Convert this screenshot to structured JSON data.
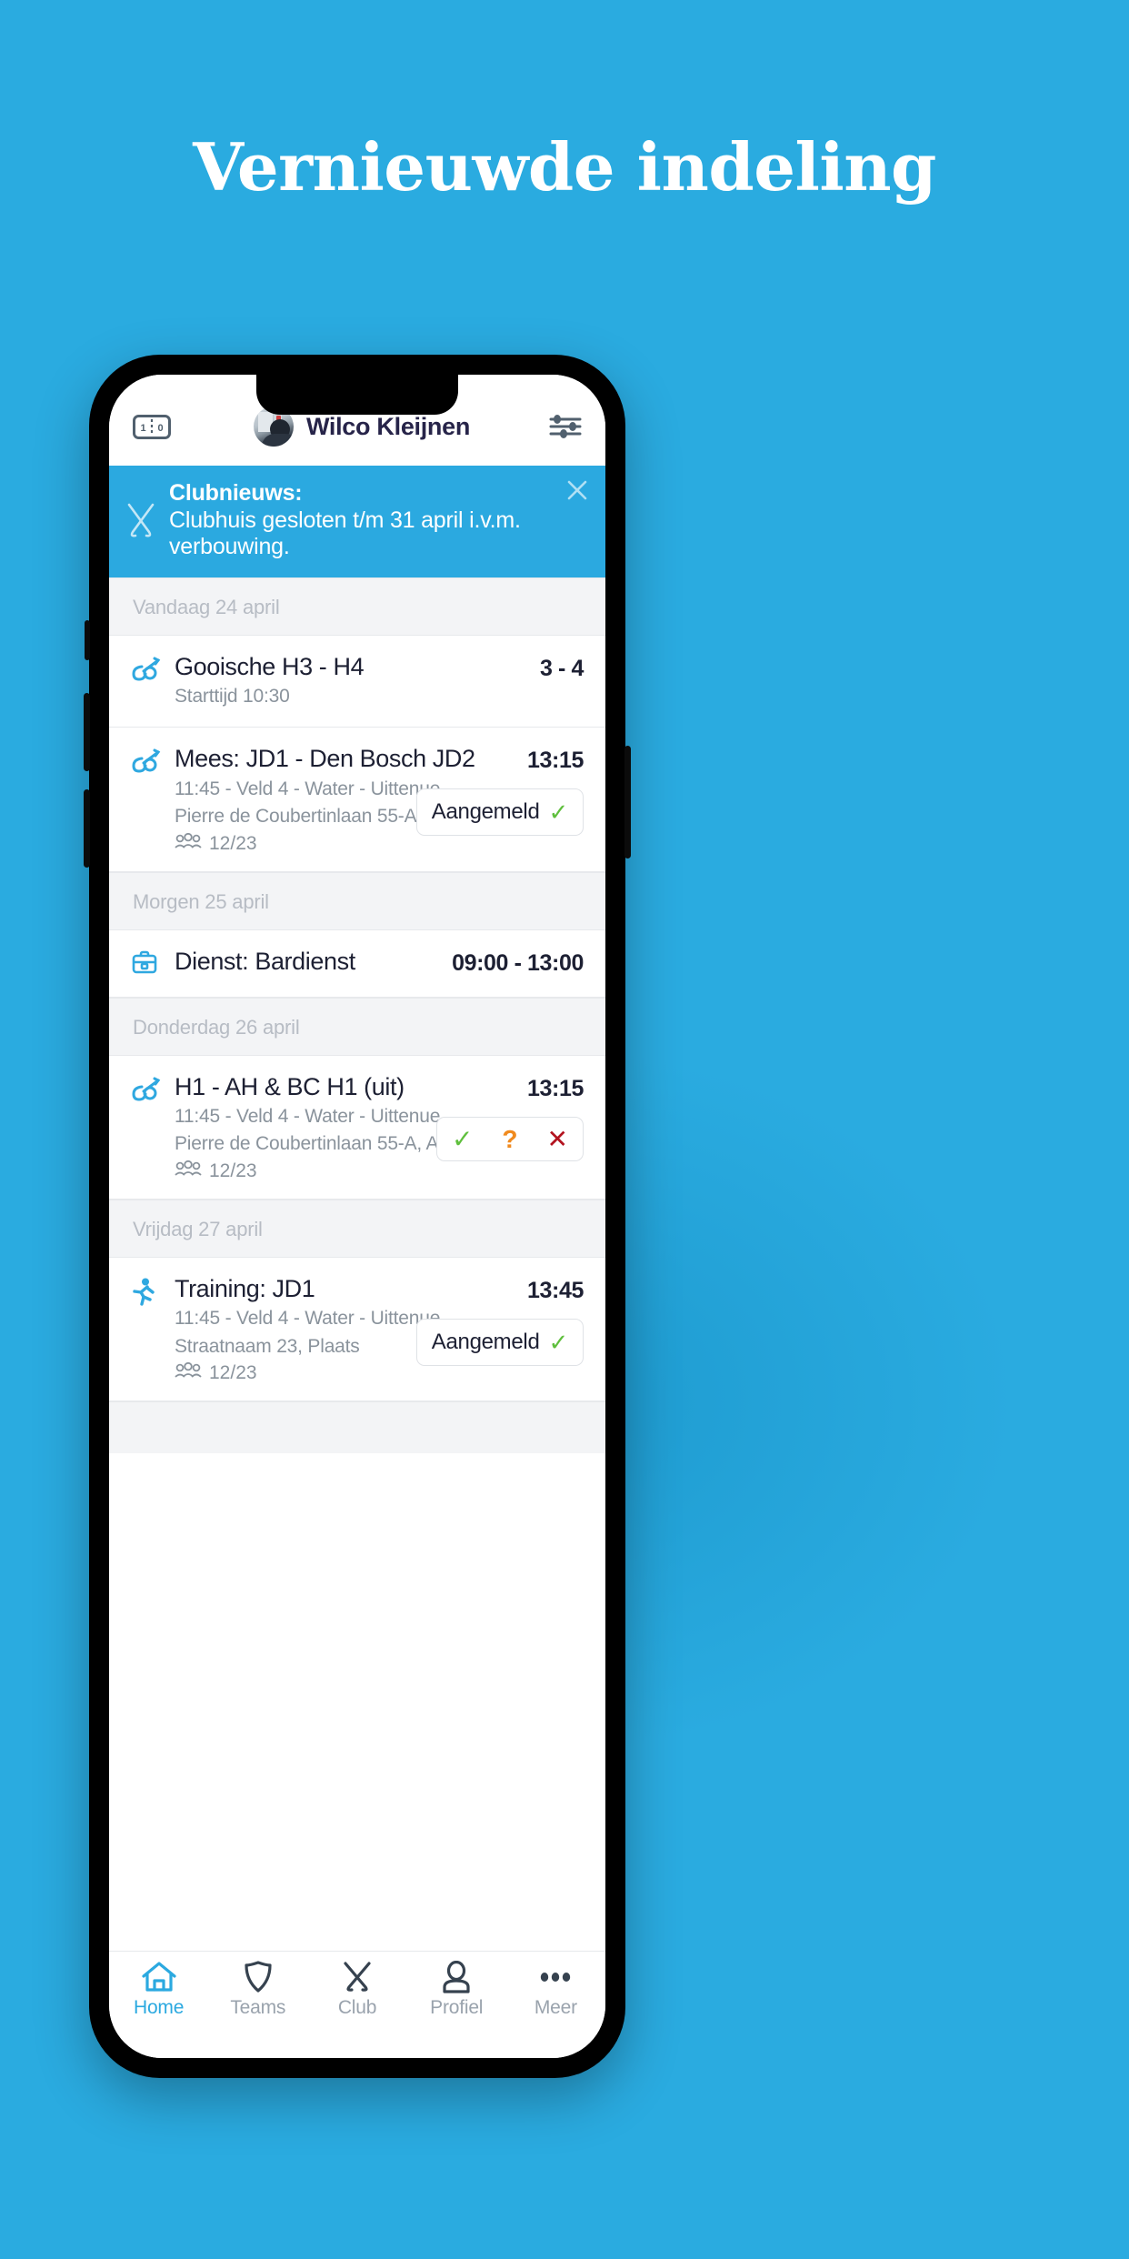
{
  "hero": {
    "title": "Vernieuwde indeling"
  },
  "colors": {
    "background": "#2aabe0",
    "accent": "#2ba9e0",
    "title_text": "#1d2033",
    "muted_text": "#8a939c",
    "day_header_text": "#b7bcc4",
    "yes_green": "#5fbf3d",
    "maybe_orange": "#f08a1e",
    "no_red": "#b3131f"
  },
  "header": {
    "score_icon": "scoreboard-icon",
    "score_left": "1",
    "score_right": "0",
    "avatar_icon": "user-avatar",
    "user_name": "Wilco Kleijnen",
    "settings_icon": "sliders-icon"
  },
  "banner": {
    "icon": "crossed-hockey-sticks-icon",
    "title": "Clubnieuws:",
    "message": "Clubhuis gesloten t/m 31 april i.v.m. verbouwing.",
    "close_icon": "close-icon"
  },
  "sections": [
    {
      "day_label": "Vandaag 24 april",
      "items": [
        {
          "icon": "hockey-stick-ball-icon",
          "title": "Gooische H3 - H4",
          "meta": [
            "Starttijd 10:30"
          ],
          "attendance": null,
          "time": "3 - 4",
          "action": null
        },
        {
          "icon": "hockey-stick-ball-icon",
          "title": "Mees: JD1 - Den Bosch JD2",
          "meta": [
            "11:45 - Veld 4 - Water - Uittenue",
            "Pierre de Coubertinlaan 55-A, Almere"
          ],
          "attendance": "12/23",
          "time": "13:15",
          "action": {
            "type": "pill",
            "label": "Aangemeld",
            "check": "✓"
          }
        }
      ]
    },
    {
      "day_label": "Morgen 25 april",
      "items": [
        {
          "icon": "briefcase-icon",
          "title": "Dienst: Bardienst",
          "meta": [],
          "attendance": null,
          "time": "09:00 - 13:00",
          "action": null
        }
      ]
    },
    {
      "day_label": "Donderdag 26 april",
      "items": [
        {
          "icon": "hockey-stick-ball-icon",
          "title": "H1 - AH & BC H1 (uit)",
          "meta": [
            "11:45 - Veld 4 - Water - Uittenue",
            "Pierre de Coubertinlaan 55-A, Almere"
          ],
          "attendance": "12/23",
          "time": "13:15",
          "action": {
            "type": "triple",
            "yes": "✓",
            "maybe": "?",
            "no": "✕"
          }
        }
      ]
    },
    {
      "day_label": "Vrijdag 27 april",
      "items": [
        {
          "icon": "running-person-icon",
          "title": "Training: JD1",
          "meta": [
            "11:45 - Veld 4 - Water - Uittenue",
            "Straatnaam 23, Plaats"
          ],
          "attendance": "12/23",
          "time": "13:45",
          "action": {
            "type": "pill",
            "label": "Aangemeld",
            "check": "✓"
          }
        }
      ]
    }
  ],
  "tabbar": {
    "items": [
      {
        "label": "Home",
        "icon": "home-icon",
        "active": true
      },
      {
        "label": "Teams",
        "icon": "shield-icon",
        "active": false
      },
      {
        "label": "Club",
        "icon": "crossed-sticks-icon",
        "active": false
      },
      {
        "label": "Profiel",
        "icon": "person-icon",
        "active": false
      },
      {
        "label": "Meer",
        "icon": "ellipsis-icon",
        "active": false
      }
    ]
  }
}
